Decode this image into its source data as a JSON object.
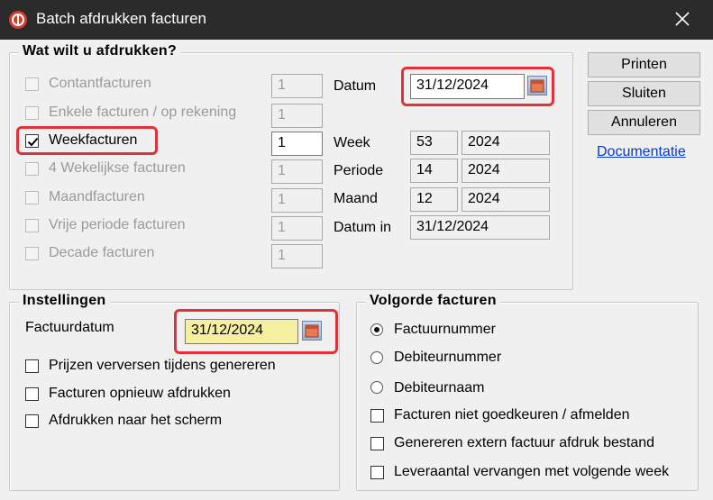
{
  "window": {
    "title": "Batch afdrukken facturen"
  },
  "print_group": {
    "legend": "Wat wilt u afdrukken?",
    "types": [
      {
        "label": "Contantfacturen",
        "count": "1",
        "checked": false,
        "enabled": false
      },
      {
        "label": "Enkele facturen / op rekening",
        "count": "1",
        "checked": false,
        "enabled": false
      },
      {
        "label": "Weekfacturen",
        "count": "1",
        "checked": true,
        "enabled": true
      },
      {
        "label": "4 Wekelijkse facturen",
        "count": "1",
        "checked": false,
        "enabled": false
      },
      {
        "label": "Maandfacturen",
        "count": "1",
        "checked": false,
        "enabled": false
      },
      {
        "label": "Vrije periode facturen",
        "count": "1",
        "checked": false,
        "enabled": false
      },
      {
        "label": "Decade facturen",
        "count": "1",
        "checked": false,
        "enabled": false
      }
    ],
    "datum_label": "Datum",
    "datum_value": "31/12/2024",
    "week_label": "Week",
    "week_value": "53",
    "week_year": "2024",
    "periode_label": "Periode",
    "periode_value": "14",
    "periode_year": "2024",
    "maand_label": "Maand",
    "maand_value": "12",
    "maand_year": "2024",
    "datum_in_label": "Datum in",
    "datum_in_value": "31/12/2024"
  },
  "buttons": {
    "print": "Printen",
    "close": "Sluiten",
    "cancel": "Annuleren",
    "documentation": "Documentatie"
  },
  "settings_group": {
    "legend": "Instellingen",
    "invoice_date_label": "Factuurdatum",
    "invoice_date_value": "31/12/2024",
    "options": [
      {
        "label": "Prijzen verversen tijdens genereren",
        "checked": false
      },
      {
        "label": "Facturen opnieuw afdrukken",
        "checked": false
      },
      {
        "label": "Afdrukken naar het scherm",
        "checked": false
      }
    ]
  },
  "order_group": {
    "legend": "Volgorde facturen",
    "sort_options": [
      {
        "label": "Factuurnummer",
        "selected": true
      },
      {
        "label": "Debiteurnummer",
        "selected": false
      },
      {
        "label": "Debiteurnaam",
        "selected": false
      }
    ],
    "options": [
      {
        "label": "Facturen niet goedkeuren / afmelden",
        "checked": false
      },
      {
        "label": "Genereren extern factuur afdruk bestand",
        "checked": false
      },
      {
        "label": "Leveraantal vervangen met volgende week",
        "checked": false
      }
    ]
  },
  "colors": {
    "highlight": "#e0323a",
    "link": "#0a38c8",
    "titlebar": "#2b2b2b",
    "date_field_yellow": "#f6eea0"
  }
}
